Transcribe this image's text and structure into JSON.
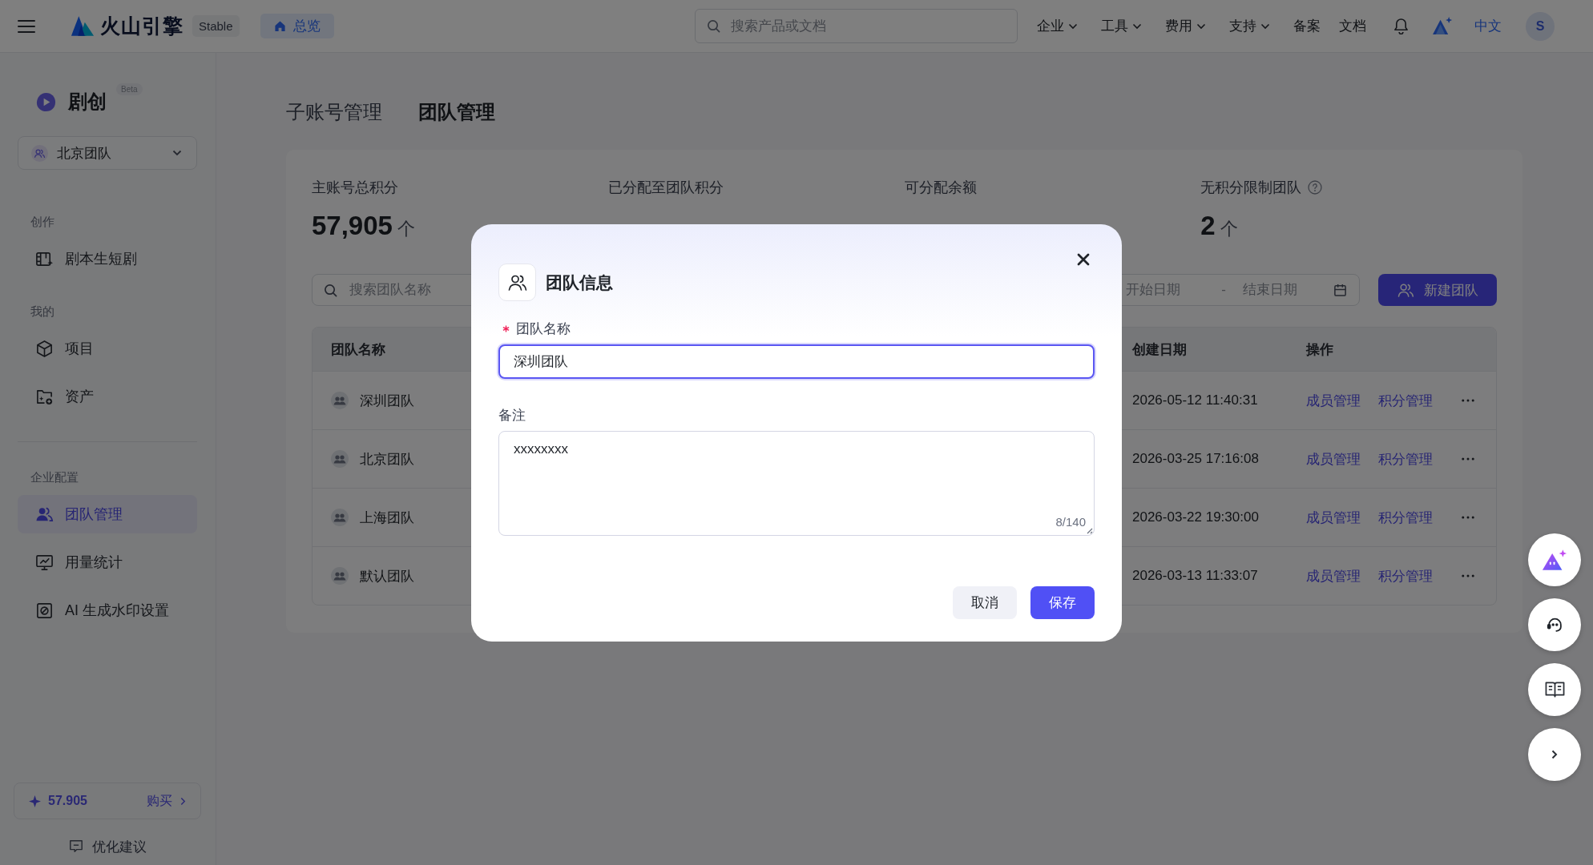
{
  "top_bar": {
    "brand": "火山引擎",
    "env_tag": "Stable",
    "home_button": "总览",
    "search": {
      "placeholder": "搜索产品或文档"
    },
    "menus": [
      {
        "label": "企业",
        "has_menu": true
      },
      {
        "label": "工具",
        "has_menu": true
      },
      {
        "label": "费用",
        "has_menu": true
      },
      {
        "label": "支持",
        "has_menu": true
      },
      {
        "label": "备案",
        "has_menu": false
      },
      {
        "label": "文档",
        "has_menu": false
      }
    ],
    "language": "中文",
    "avatar": "S"
  },
  "sidebar": {
    "app_name": "剧创",
    "app_tag": "Beta",
    "team_selector": "北京团队",
    "sections": [
      {
        "title": "创作",
        "divider": false,
        "items": [
          {
            "label": "剧本生短剧",
            "selected": false
          }
        ]
      },
      {
        "title": "我的",
        "divider": false,
        "items": [
          {
            "label": "项目",
            "selected": false
          },
          {
            "label": "资产",
            "selected": false
          }
        ]
      },
      {
        "title": "企业配置",
        "divider": true,
        "items": [
          {
            "label": "团队管理",
            "selected": true
          },
          {
            "label": "用量统计",
            "selected": false
          },
          {
            "label": "AI 生成水印设置",
            "selected": false
          }
        ]
      }
    ],
    "credits": "57.905",
    "buy": "购买",
    "feedback": "优化建议"
  },
  "tabs": [
    {
      "label": "子账号管理",
      "selected": false
    },
    {
      "label": "团队管理",
      "selected": true
    }
  ],
  "stats": [
    {
      "label": "主账号总积分",
      "value": "57,905",
      "unit": "个",
      "help": false
    },
    {
      "label": "已分配至团队积分",
      "help": false
    },
    {
      "label": "可分配余额",
      "help": false
    },
    {
      "label": "无积分限制团队",
      "value": "2",
      "unit": "个",
      "help": true
    }
  ],
  "toolbar": {
    "search": {
      "placeholder": "搜索团队名称"
    },
    "date_range": {
      "start_placeholder": "开始日期",
      "separator": "-",
      "end_placeholder": "结束日期"
    },
    "new_button": "新建团队"
  },
  "table": {
    "columns": [
      "团队名称",
      "创建日期",
      "操作"
    ],
    "rows": [
      {
        "name": "深圳团队",
        "created": "2026-05-12 11:40:31",
        "actions": [
          "成员管理",
          "积分管理"
        ]
      },
      {
        "name": "北京团队",
        "created": "2026-03-25 17:16:08",
        "actions": [
          "成员管理",
          "积分管理"
        ]
      },
      {
        "name": "上海团队",
        "created": "2026-03-22 19:30:00",
        "actions": [
          "成员管理",
          "积分管理"
        ]
      },
      {
        "name": "默认团队",
        "created": "2026-03-13 11:33:07",
        "actions": [
          "成员管理",
          "积分管理"
        ]
      }
    ]
  },
  "dialog": {
    "title": "团队信息",
    "fields": [
      {
        "kind": "input",
        "label": "团队名称",
        "required": true,
        "focused": true,
        "value": "深圳团队"
      },
      {
        "kind": "textarea",
        "label": "备注",
        "required": false,
        "focused": false,
        "value": "xxxxxxxx",
        "counter": "8/140"
      }
    ],
    "buttons": [
      {
        "label": "取消",
        "kind": "secondary"
      },
      {
        "label": "保存",
        "kind": "primary"
      }
    ]
  }
}
